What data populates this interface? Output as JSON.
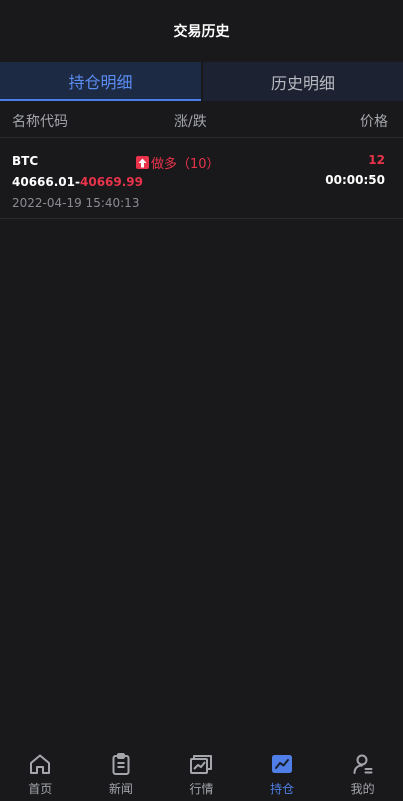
{
  "header": {
    "title": "交易历史"
  },
  "tabs": [
    {
      "label": "持仓明细",
      "active": true
    },
    {
      "label": "历史明细",
      "active": false
    }
  ],
  "columns": {
    "name": "名称代码",
    "change": "涨/跌",
    "price": "价格"
  },
  "rows": [
    {
      "symbol": "BTC",
      "direction": "做多（10）",
      "direction_icon": "arrow-up-icon",
      "quantity": "12",
      "open_price": "40666.01",
      "separator": "-",
      "close_price": "40669.99",
      "duration": "00:00:50",
      "time": "2022-04-19 15:40:13"
    }
  ],
  "tabbar": [
    {
      "label": "首页",
      "icon": "home-icon"
    },
    {
      "label": "新闻",
      "icon": "news-icon"
    },
    {
      "label": "行情",
      "icon": "market-icon"
    },
    {
      "label": "持仓",
      "icon": "position-icon",
      "active": true
    },
    {
      "label": "我的",
      "icon": "profile-icon"
    }
  ],
  "colors": {
    "background": "#19191b",
    "accent": "#4f7fe6",
    "up": "#e8334b",
    "text_muted": "#a4a6ab"
  }
}
